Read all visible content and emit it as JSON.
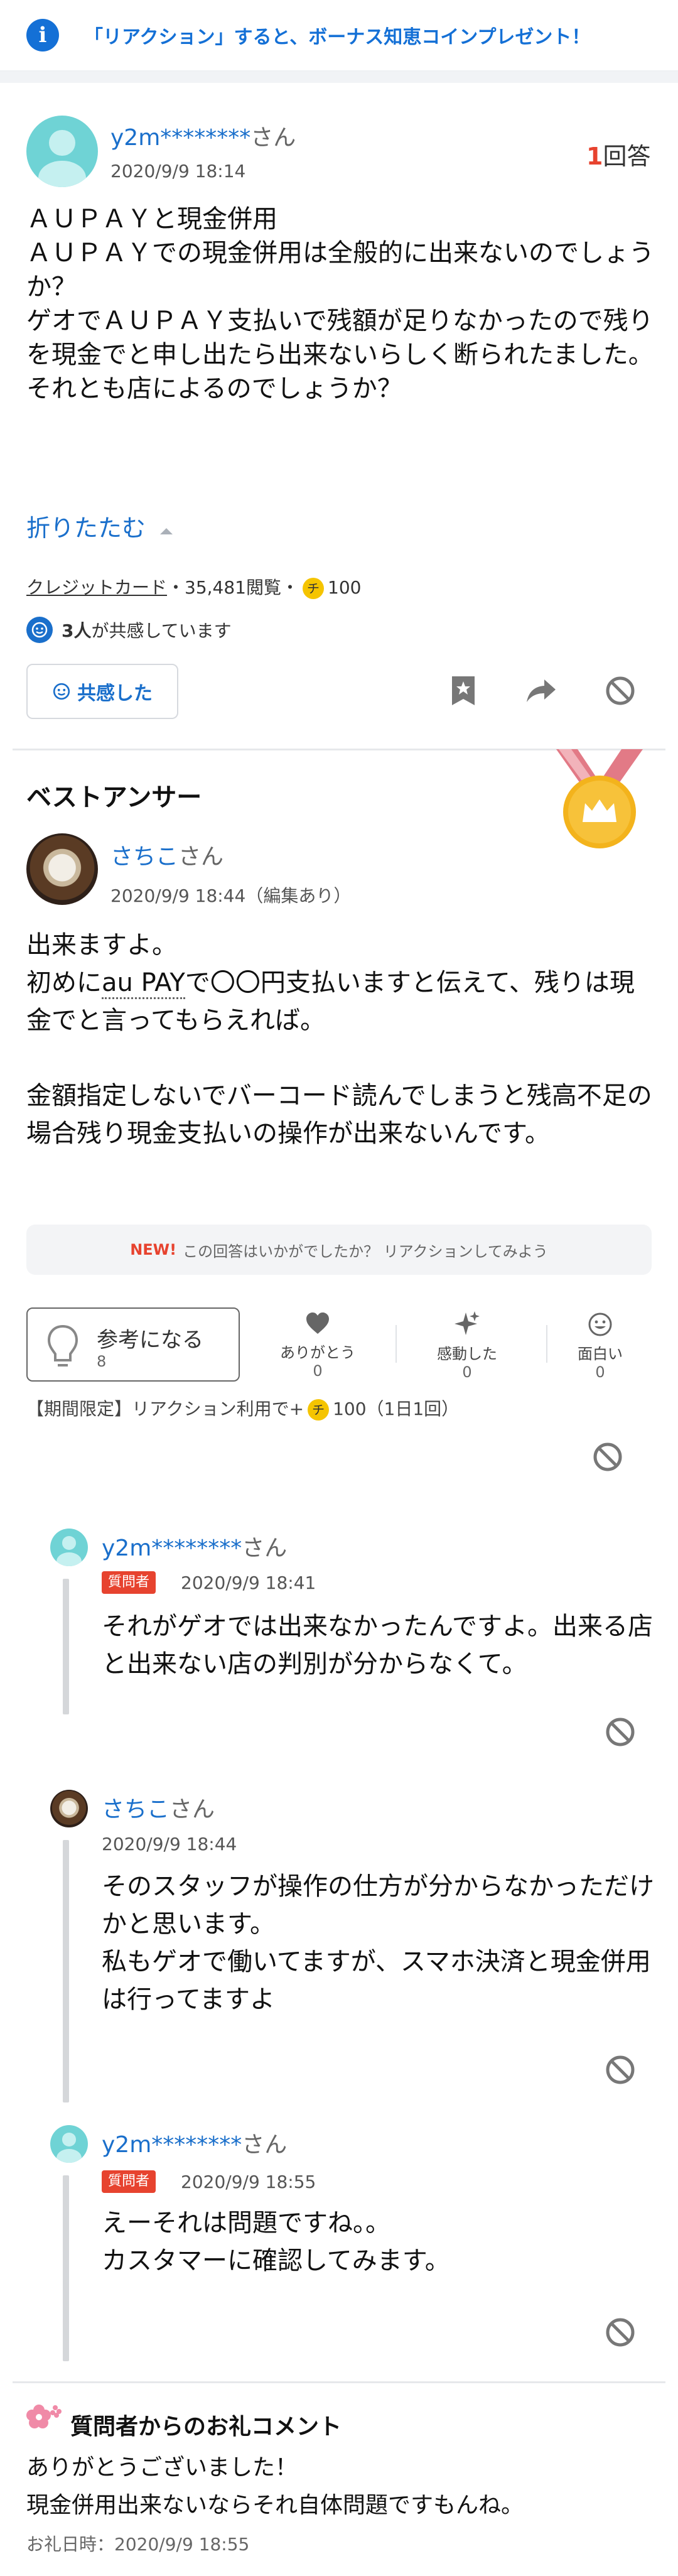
{
  "banner": {
    "text": "「リアクション」すると、ボーナス知恵コインプレゼント！"
  },
  "question": {
    "user": "y2m********",
    "san": "さん",
    "date": "2020/9/9 18:14",
    "answers_count": "1",
    "answers_label": "回答",
    "lines": [
      "ＡＵＰＡＹと現金併用",
      "ＡＵＰＡＹでの現金併用は全般的に出来ないのでしょうか？",
      "ゲオでＡＵＰＡＹ支払いで残額が足りなかったので残りを現金でと申し出たら出来ないらしく断られたました。",
      "それとも店によるのでしょうか？"
    ],
    "fold_label": "折りたたむ",
    "category": "クレジットカード",
    "views": "・35,481閲覧・",
    "coin": "チ",
    "coins": "100",
    "empathy_count": "3人",
    "empathy_text": "が共感しています",
    "empathy_button": "共感した"
  },
  "best_answer": {
    "title": "ベストアンサー",
    "user": "さちこ",
    "san": "さん",
    "date": "2020/9/9 18:44（編集あり）",
    "line1": "出来ますよ。",
    "line2_pre": "初めに",
    "line2_link": "au PAY",
    "line2_post": "で〇〇円支払いますと伝えて、残りは現金でと言ってもらえれば。",
    "line3": "金額指定しないでバーコード読んでしまうと残高不足の場合残り現金支払いの操作が出来ないんです。",
    "reaction_new": "NEW!",
    "reaction_prompt": "この回答はいかがでしたか？ リアクションしてみよう",
    "ref_label": "参考になる",
    "ref_count": "8",
    "thanks_label": "ありがとう",
    "thanks_count": "0",
    "moved_label": "感動した",
    "moved_count": "0",
    "funny_label": "面白い",
    "funny_count": "0",
    "limited_text": "【期間限定】リアクション利用で+",
    "limited_coin": "チ",
    "limited_tail": "100（1日1回）"
  },
  "replies": [
    {
      "user": "y2m********",
      "san": "さん",
      "badge": "質問者",
      "date": "2020/9/9 18:41",
      "text": "それがゲオでは出来なかったんですよ。出来る店と出来ない店の判別が分からなくて。"
    },
    {
      "user": "さちこ",
      "san": "さん",
      "badge": "",
      "date": "2020/9/9 18:44",
      "text": "そのスタッフが操作の仕方が分からなかっただけかと思います。\n私もゲオで働いてますが、スマホ決済と現金併用は行ってますよ"
    },
    {
      "user": "y2m********",
      "san": "さん",
      "badge": "質問者",
      "date": "2020/9/9 18:55",
      "text": "えーそれは問題ですね。。\nカスタマーに確認してみます。"
    }
  ],
  "thanks_comment": {
    "title": "質問者からのお礼コメント",
    "text": "ありがとうございました！\n現金併用出来ないならそれ自体問題ですもんね。",
    "date_label": "お礼日時：2020/9/9 18:55"
  },
  "colors": {
    "accent": "#1a6fcb",
    "badge": "#e7432f",
    "coin": "#f5c400",
    "medal": "#f3b31c"
  }
}
